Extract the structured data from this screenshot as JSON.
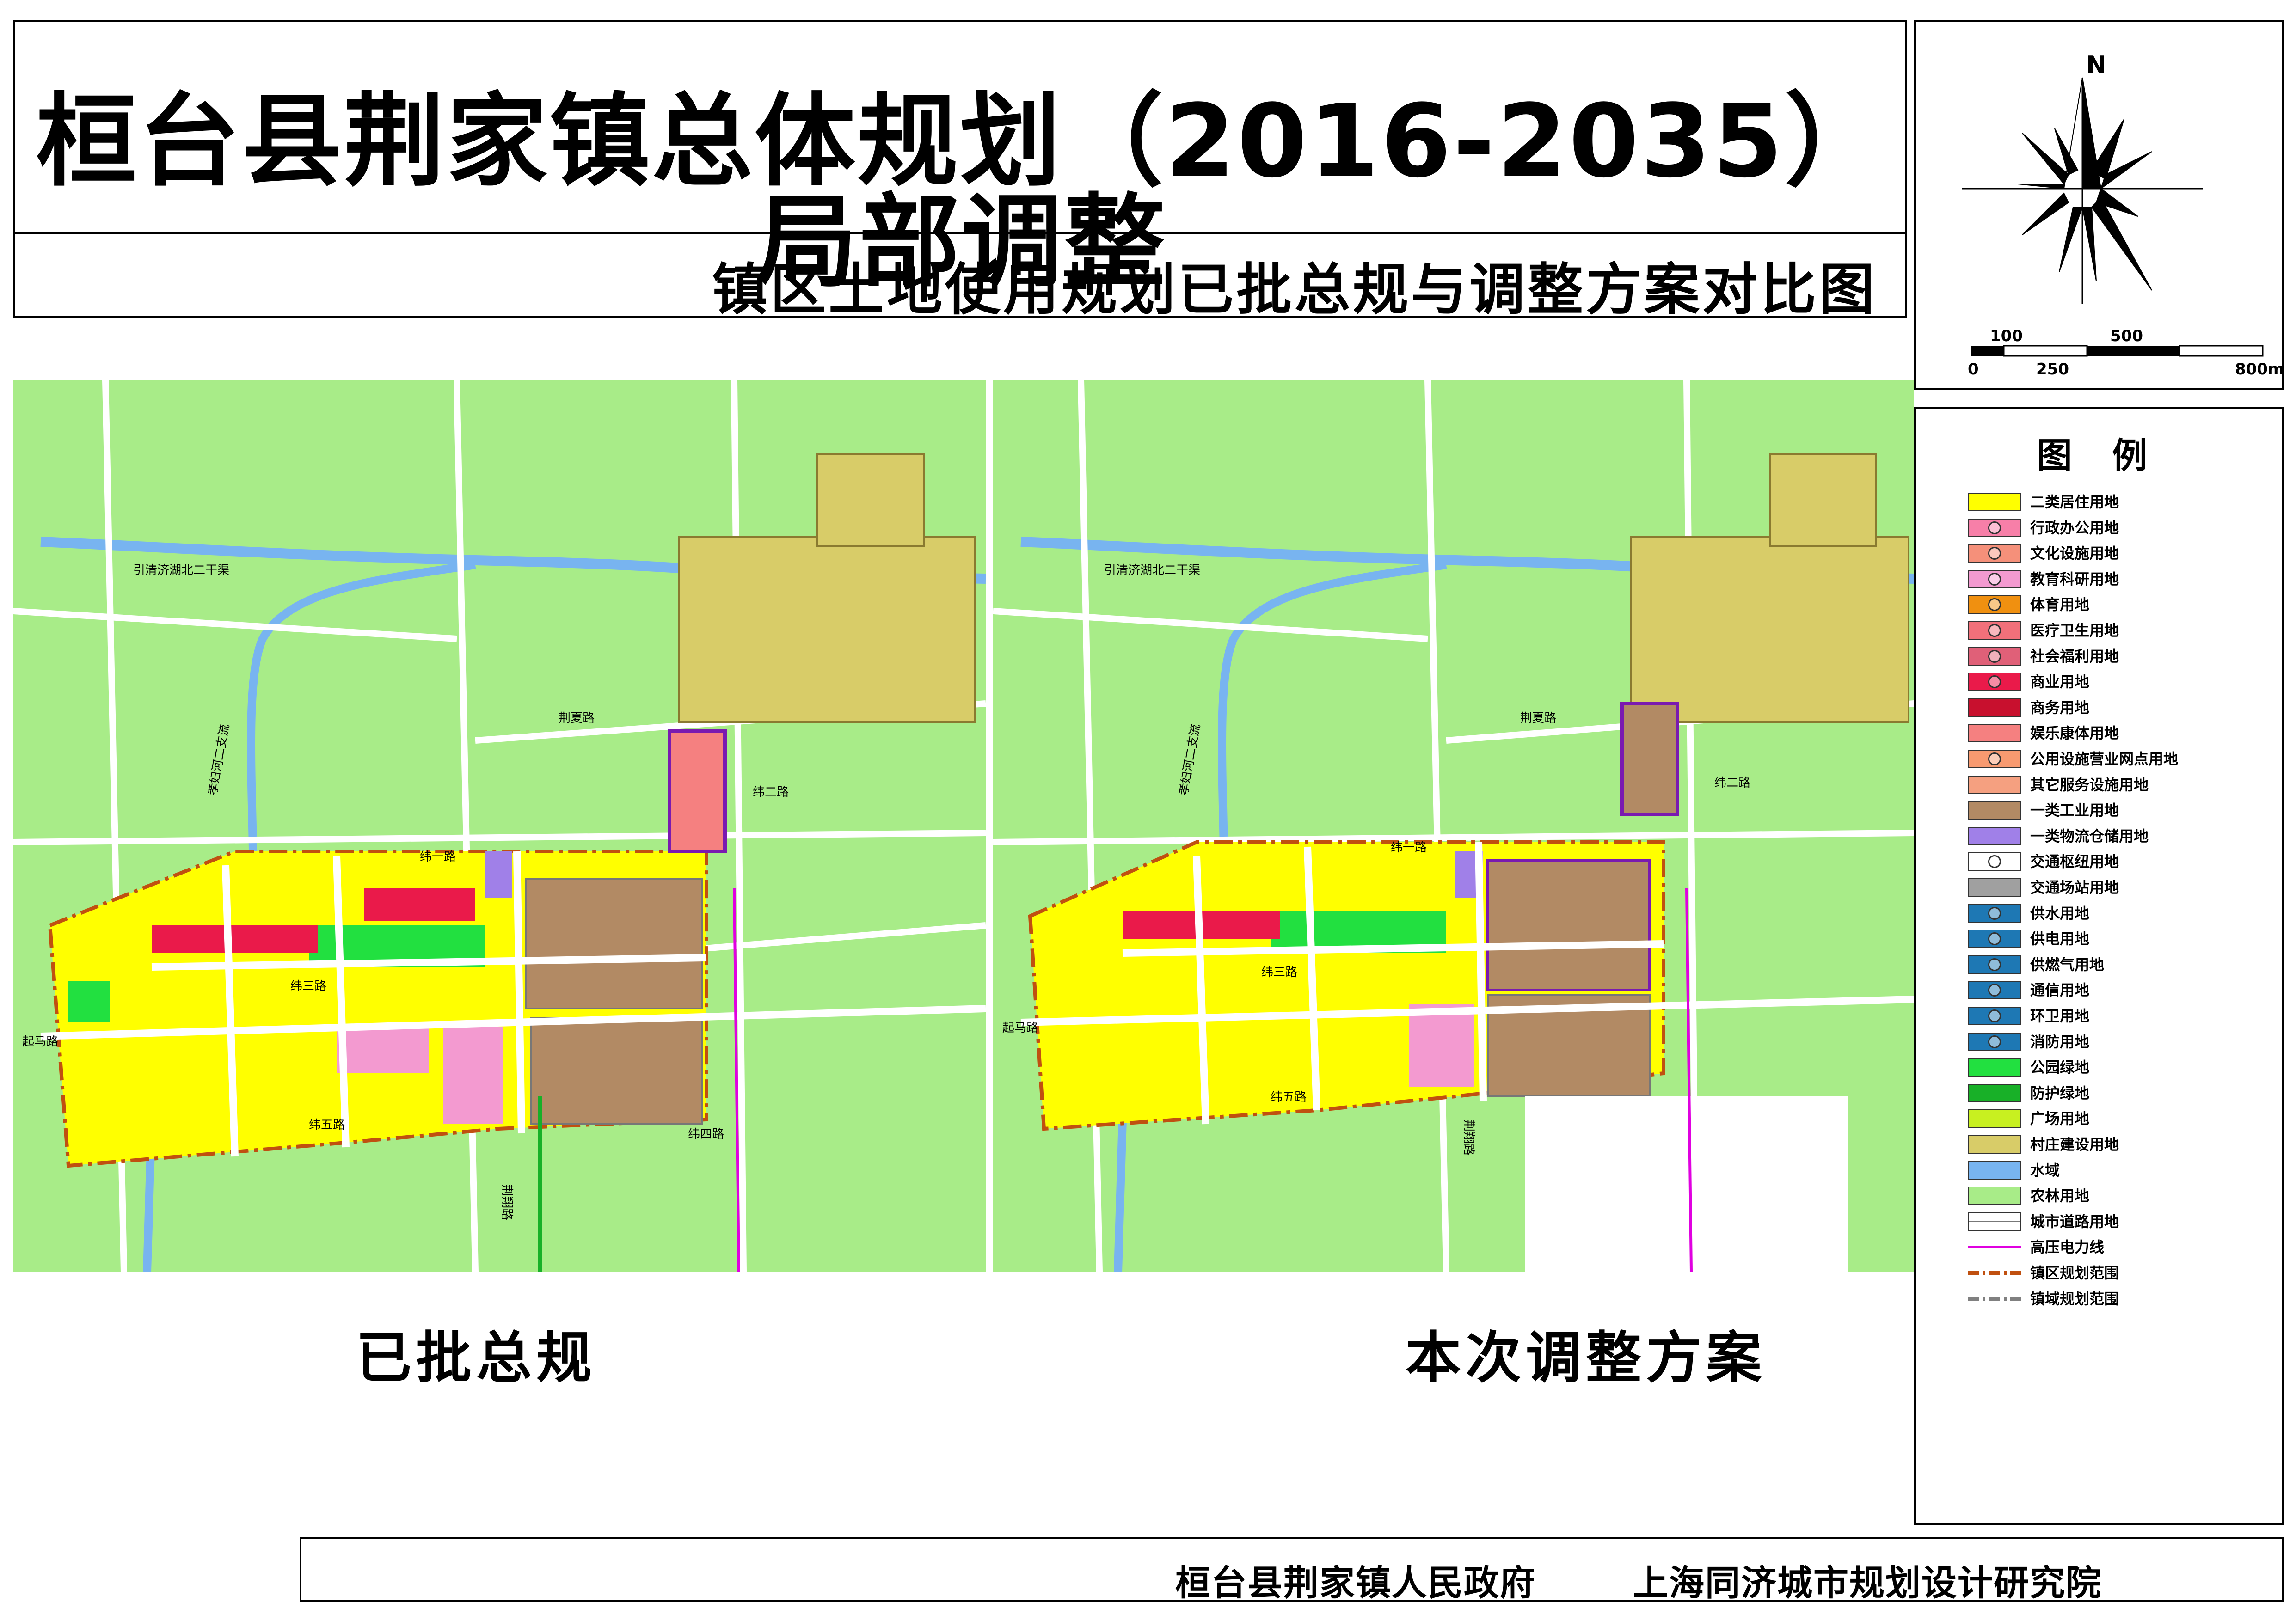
{
  "header": {
    "title": "桓台县荆家镇总体规划（2016-2035）局部调整",
    "subtitle": "镇区土地使用规划已批总规与调整方案对比图"
  },
  "compass": {
    "north_label": "N"
  },
  "scale_bar": {
    "top_labels": [
      "100",
      "500"
    ],
    "bottom_labels": [
      "0",
      "250",
      "800m"
    ]
  },
  "legend": {
    "title": "图 例",
    "items": [
      {
        "label": "二类居住用地",
        "color": "#ffff00",
        "icon": "none"
      },
      {
        "label": "行政办公用地",
        "color": "#f77fa8",
        "icon": "star-icon"
      },
      {
        "label": "文化设施用地",
        "color": "#f5907a",
        "icon": "culture-icon"
      },
      {
        "label": "教育科研用地",
        "color": "#f39ad0",
        "icon": "education-icon"
      },
      {
        "label": "体育用地",
        "color": "#f09010",
        "icon": "sports-icon"
      },
      {
        "label": "医疗卫生用地",
        "color": "#f2707a",
        "icon": "medical-icon"
      },
      {
        "label": "社会福利用地",
        "color": "#e06078",
        "icon": "welfare-icon"
      },
      {
        "label": "商业用地",
        "color": "#ea1a4a",
        "icon": "commerce-icon"
      },
      {
        "label": "商务用地",
        "color": "#c8102e",
        "icon": "none"
      },
      {
        "label": "娱乐康体用地",
        "color": "#f58080",
        "icon": "none"
      },
      {
        "label": "公用设施营业网点用地",
        "color": "#f79a70",
        "icon": "utility-outlet-icon"
      },
      {
        "label": "其它服务设施用地",
        "color": "#f5a080",
        "icon": "none"
      },
      {
        "label": "一类工业用地",
        "color": "#b28a64",
        "icon": "none"
      },
      {
        "label": "一类物流仓储用地",
        "color": "#a080e8",
        "icon": "none"
      },
      {
        "label": "交通枢纽用地",
        "color": "#ffffff",
        "icon": "transit-hub-icon"
      },
      {
        "label": "交通场站用地",
        "color": "#a0a0a0",
        "icon": "none"
      },
      {
        "label": "供水用地",
        "color": "#1e78b4",
        "icon": "water-supply-icon"
      },
      {
        "label": "供电用地",
        "color": "#1e78b4",
        "icon": "power-supply-icon"
      },
      {
        "label": "供燃气用地",
        "color": "#1e78b4",
        "icon": "gas-supply-icon"
      },
      {
        "label": "通信用地",
        "color": "#1e78b4",
        "icon": "telecom-icon"
      },
      {
        "label": "环卫用地",
        "color": "#1e78b4",
        "icon": "sanitation-icon"
      },
      {
        "label": "消防用地",
        "color": "#1e78b4",
        "icon": "fire-station-icon"
      },
      {
        "label": "公园绿地",
        "color": "#22e040",
        "icon": "none"
      },
      {
        "label": "防护绿地",
        "color": "#18b028",
        "icon": "none"
      },
      {
        "label": "广场用地",
        "color": "#c8f020",
        "icon": "none"
      },
      {
        "label": "村庄建设用地",
        "color": "#d8cc68",
        "icon": "none"
      },
      {
        "label": "水域",
        "color": "#78b4f0",
        "icon": "none"
      },
      {
        "label": "农林用地",
        "color": "#a8ec88",
        "icon": "none"
      },
      {
        "label": "城市道路用地",
        "color": "#ffffff",
        "icon": "road-icon"
      },
      {
        "label": "高压电力线",
        "color": "#e000e0",
        "icon": "power-line-icon"
      },
      {
        "label": "镇区规划范围",
        "color": "#c05010",
        "icon": "town-boundary-icon"
      },
      {
        "label": "镇域规划范围",
        "color": "#808080",
        "icon": "county-boundary-icon"
      }
    ]
  },
  "maps": {
    "left": {
      "caption": "已批总规",
      "road_labels": [
        "引清济湖北二干渠",
        "孝妇河二支流",
        "荆夏路",
        "纬一路",
        "纬二路",
        "纬三路",
        "纬五路",
        "起马路",
        "荆翔路",
        "纬四路"
      ]
    },
    "right": {
      "caption": "本次调整方案",
      "road_labels": [
        "引清济湖北二干渠",
        "孝妇河二支流",
        "荆夏路",
        "纬一路",
        "纬二路",
        "纬三路",
        "纬五路",
        "起马路",
        "荆翔路"
      ]
    }
  },
  "footer": {
    "left": "桓台县荆家镇人民政府",
    "right": "上海同济城市规划设计研究院"
  }
}
